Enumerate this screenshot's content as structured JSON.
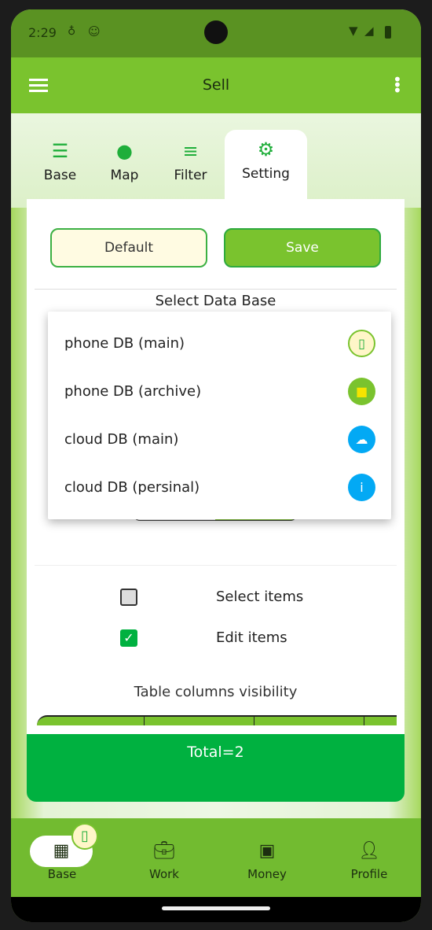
{
  "status": {
    "time": "2:29"
  },
  "appbar": {
    "title": "Sell"
  },
  "tabs": [
    {
      "label": "Base",
      "icon": "list-icon"
    },
    {
      "label": "Map",
      "icon": "globe-icon"
    },
    {
      "label": "Filter",
      "icon": "filter-icon"
    },
    {
      "label": "Setting",
      "icon": "gear-sparkle-icon",
      "active": true
    }
  ],
  "buttons": {
    "default": "Default",
    "save": "Save"
  },
  "db": {
    "title": "Select Data Base",
    "options": [
      {
        "label": "phone DB (main)",
        "icon": "phone-icon",
        "color": "#fff6c8"
      },
      {
        "label": "phone DB (archive)",
        "icon": "archive-icon",
        "color": "#7ac32e"
      },
      {
        "label": "cloud DB (main)",
        "icon": "cloud-check-icon",
        "color": "#03a9f4"
      },
      {
        "label": "cloud DB (persinal)",
        "icon": "person-icon",
        "color": "#03a9f4"
      }
    ]
  },
  "checks": [
    {
      "label": "Select items",
      "checked": false
    },
    {
      "label": "Edit items",
      "checked": true
    }
  ],
  "table": {
    "title": "Table columns visibility"
  },
  "total": "Total=2",
  "nav": [
    {
      "label": "Base",
      "active": true
    },
    {
      "label": "Work"
    },
    {
      "label": "Money"
    },
    {
      "label": "Profile"
    }
  ],
  "colors": {
    "accent": "#7ac32e",
    "status": "#5a9222",
    "total": "#00b140"
  }
}
